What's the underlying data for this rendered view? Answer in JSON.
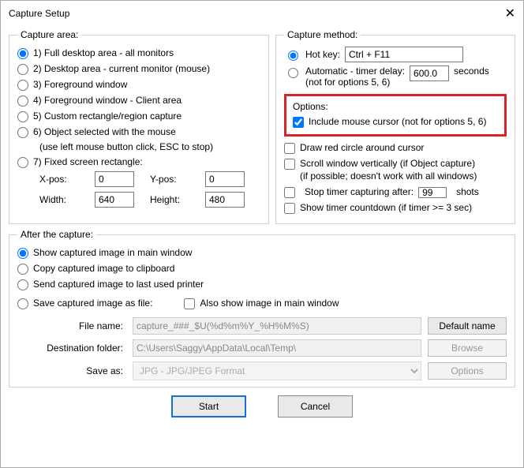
{
  "window": {
    "title": "Capture Setup"
  },
  "capture_area": {
    "legend": "Capture area:",
    "options": {
      "full_desktop": "1) Full desktop area - all monitors",
      "desktop_area": "2) Desktop area - current monitor (mouse)",
      "foreground": "3) Foreground window",
      "foreground_client": "4) Foreground window - Client area",
      "custom_rect": "5) Custom rectangle/region capture",
      "object_selected": "6) Object selected with the mouse",
      "object_selected_note": "(use left mouse button click, ESC to stop)",
      "fixed_rect": "7) Fixed screen rectangle:"
    },
    "xpos_label": "X-pos:",
    "xpos_value": "0",
    "ypos_label": "Y-pos:",
    "ypos_value": "0",
    "width_label": "Width:",
    "width_value": "640",
    "height_label": "Height:",
    "height_value": "480"
  },
  "capture_method": {
    "legend": "Capture method:",
    "hotkey_label": "Hot key:",
    "hotkey_value": "Ctrl + F11",
    "automatic_label": "Automatic - timer delay:",
    "automatic_note": "(not for options 5, 6)",
    "automatic_value": "600.0",
    "seconds_label": "seconds"
  },
  "options": {
    "legend": "Options:",
    "include_cursor": "Include mouse cursor (not for options 5, 6)",
    "draw_red_circle": "Draw red circle around cursor",
    "scroll_window": "Scroll window vertically (if Object capture)",
    "scroll_window_note": "(if possible; doesn't work with all windows)",
    "stop_timer_prefix": "Stop timer capturing after:",
    "stop_timer_value": "99",
    "stop_timer_suffix": "shots",
    "show_countdown": "Show timer countdown (if timer >= 3 sec)"
  },
  "after_capture": {
    "legend": "After the capture:",
    "show_main": "Show captured image in main window",
    "copy_clipboard": "Copy captured image to clipboard",
    "send_printer": "Send captured image to last used printer",
    "save_file": "Save captured image as file:",
    "also_show": "Also show image in main window",
    "filename_label": "File name:",
    "filename_value": "capture_###_$U(%d%m%Y_%H%M%S)",
    "default_name_btn": "Default name",
    "dest_label": "Destination folder:",
    "dest_value": "C:\\Users\\Saggy\\AppData\\Local\\Temp\\",
    "browse_btn": "Browse",
    "saveas_label": "Save as:",
    "saveas_value": "JPG - JPG/JPEG Format",
    "options_btn": "Options"
  },
  "footer": {
    "start": "Start",
    "cancel": "Cancel"
  }
}
